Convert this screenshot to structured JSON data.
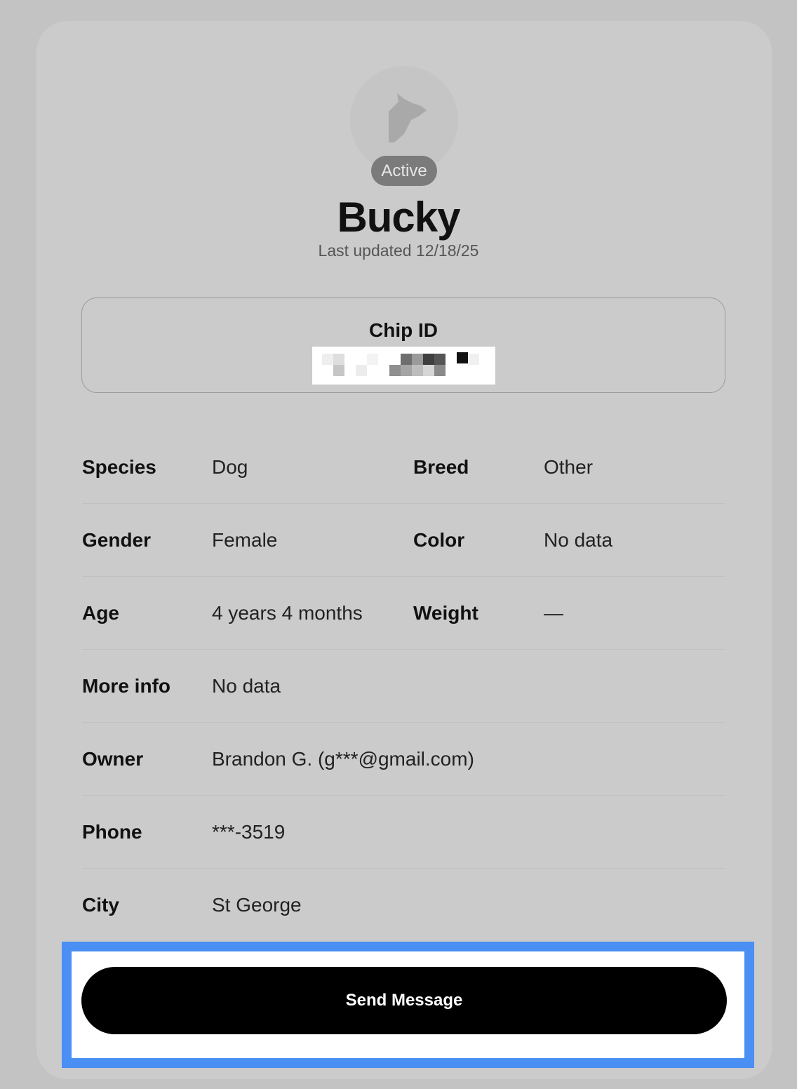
{
  "profile": {
    "status_badge": "Active",
    "name": "Bucky",
    "last_updated": "Last updated 12/18/25",
    "avatar_icon": "dog-icon"
  },
  "chip": {
    "label": "Chip ID",
    "value_redacted_icon": "pixelated-redaction"
  },
  "details": {
    "species_label": "Species",
    "species_value": "Dog",
    "breed_label": "Breed",
    "breed_value": "Other",
    "gender_label": "Gender",
    "gender_value": "Female",
    "color_label": "Color",
    "color_value": "No data",
    "age_label": "Age",
    "age_value": "4 years 4 months",
    "weight_label": "Weight",
    "weight_value": "—",
    "more_info_label": "More info",
    "more_info_value": "No data",
    "owner_label": "Owner",
    "owner_value": "Brandon G. (g***@gmail.com)",
    "phone_label": "Phone",
    "phone_value": "***-3519",
    "city_label": "City",
    "city_value": "St George"
  },
  "actions": {
    "send_message_label": "Send Message"
  },
  "colors": {
    "background": "#c3c3c3",
    "card": "#cbcbcb",
    "badge": "#7b7b7b",
    "button": "#000000",
    "highlight_border": "#4a8ff3"
  }
}
